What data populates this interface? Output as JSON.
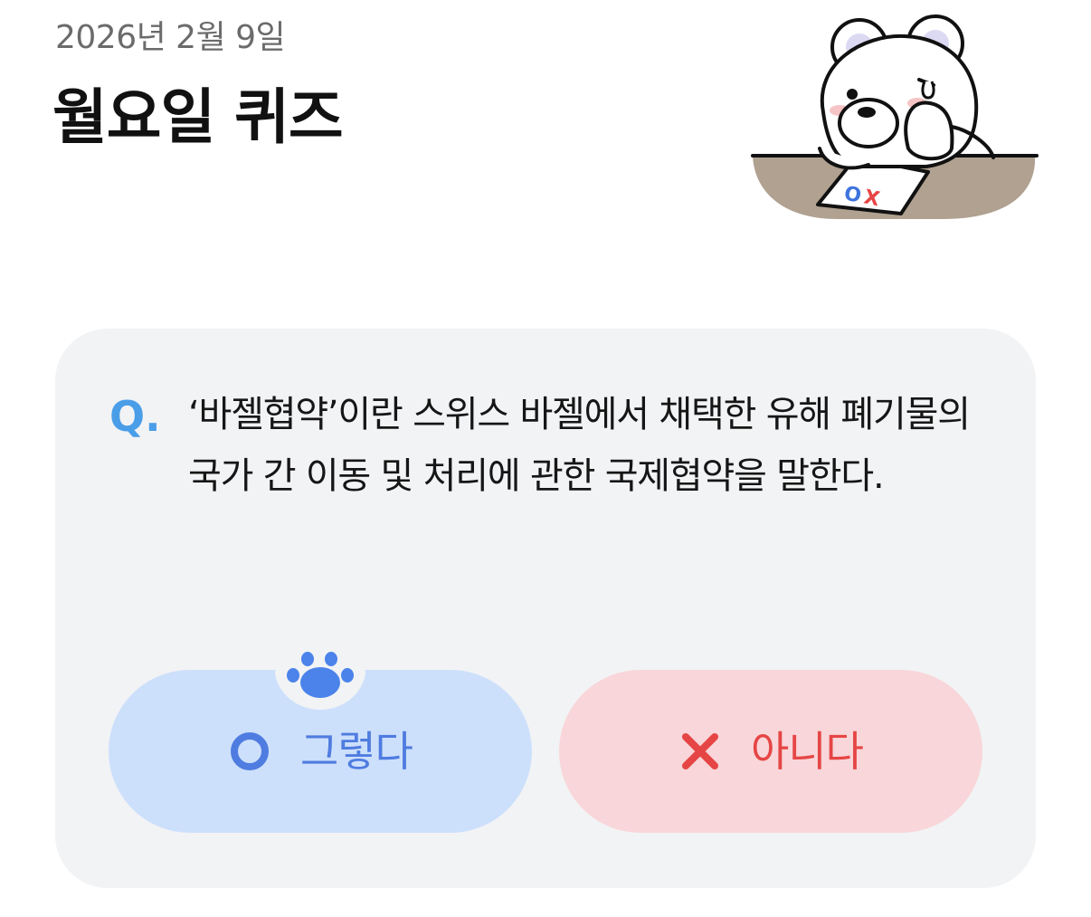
{
  "header": {
    "date": "2026년 2월 9일",
    "title": "월요일 퀴즈"
  },
  "illustration": {
    "name": "bear-thinking-illustration",
    "paper_marks": "OX"
  },
  "quiz": {
    "q_label": "Q.",
    "question": "‘바젤협약’이란 스위스 바젤에서 채택한 유해 폐기물의 국가 간 이동 및 처리에 관한 국제협약을 말한다."
  },
  "answers": {
    "yes_label": "그렇다",
    "no_label": "아니다",
    "selected": "yes"
  },
  "colors": {
    "card_bg": "#f2f3f5",
    "yes_bg": "#cde0fb",
    "yes_fg": "#4f7ce0",
    "no_bg": "#f8d6d9",
    "no_fg": "#e64545",
    "q_accent": "#4a9ee8"
  }
}
